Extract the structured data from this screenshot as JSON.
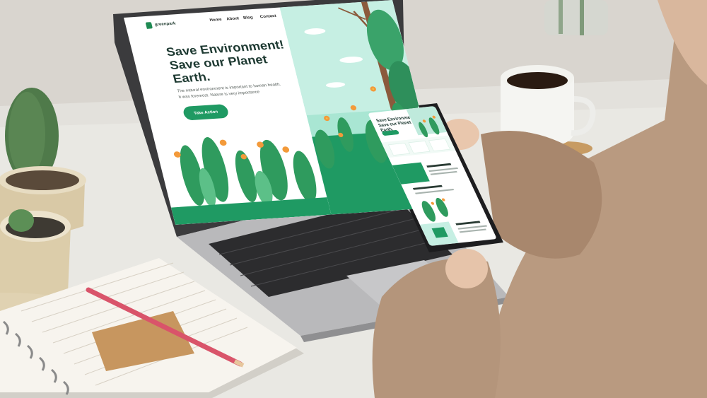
{
  "laptop_site": {
    "logo_text": "greenpark",
    "nav": [
      "Home",
      "About",
      "Blog",
      "Contact"
    ],
    "hero_title": "Save Environment! Save our Planet Earth.",
    "hero_body": "The natural environment is important to human health. It was foremost. Nature is very importance",
    "cta_label": "Take Action",
    "accent": "#1f9a63",
    "brand_dark": "#1e3a32"
  },
  "phone_site": {
    "hero_title": "Save Environment! Save our Planet Earth."
  }
}
